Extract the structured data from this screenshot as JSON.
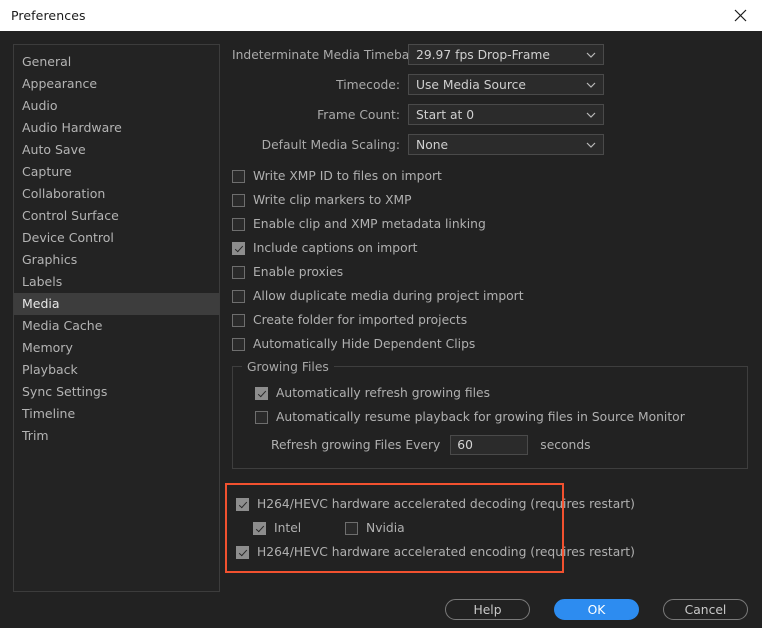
{
  "window": {
    "title": "Preferences",
    "close_icon": "close-icon"
  },
  "sidebar": {
    "items": [
      {
        "label": "General",
        "selected": false
      },
      {
        "label": "Appearance",
        "selected": false
      },
      {
        "label": "Audio",
        "selected": false
      },
      {
        "label": "Audio Hardware",
        "selected": false
      },
      {
        "label": "Auto Save",
        "selected": false
      },
      {
        "label": "Capture",
        "selected": false
      },
      {
        "label": "Collaboration",
        "selected": false
      },
      {
        "label": "Control Surface",
        "selected": false
      },
      {
        "label": "Device Control",
        "selected": false
      },
      {
        "label": "Graphics",
        "selected": false
      },
      {
        "label": "Labels",
        "selected": false
      },
      {
        "label": "Media",
        "selected": true
      },
      {
        "label": "Media Cache",
        "selected": false
      },
      {
        "label": "Memory",
        "selected": false
      },
      {
        "label": "Playback",
        "selected": false
      },
      {
        "label": "Sync Settings",
        "selected": false
      },
      {
        "label": "Timeline",
        "selected": false
      },
      {
        "label": "Trim",
        "selected": false
      }
    ]
  },
  "main": {
    "dropdowns": [
      {
        "label": "Indeterminate Media Timebase:",
        "value": "29.97 fps Drop-Frame"
      },
      {
        "label": "Timecode:",
        "value": "Use Media Source"
      },
      {
        "label": "Frame Count:",
        "value": "Start at 0"
      },
      {
        "label": "Default Media Scaling:",
        "value": "None"
      }
    ],
    "checkboxes": [
      {
        "label": "Write XMP ID to files on import",
        "checked": false
      },
      {
        "label": "Write clip markers to XMP",
        "checked": false
      },
      {
        "label": "Enable clip and XMP metadata linking",
        "checked": false
      },
      {
        "label": "Include captions on import",
        "checked": true
      },
      {
        "label": "Enable proxies",
        "checked": false
      },
      {
        "label": "Allow duplicate media during project import",
        "checked": false
      },
      {
        "label": "Create folder for imported projects",
        "checked": false
      },
      {
        "label": "Automatically Hide Dependent Clips",
        "checked": false
      }
    ],
    "growing_files": {
      "legend": "Growing Files",
      "auto_refresh": {
        "label": "Automatically refresh growing files",
        "checked": true
      },
      "auto_resume": {
        "label": "Automatically resume playback for growing files in Source Monitor",
        "checked": false
      },
      "refresh_label": "Refresh growing Files Every",
      "refresh_value": "60",
      "seconds_label": "seconds"
    },
    "hardware": {
      "decoding": {
        "label": "H264/HEVC hardware accelerated decoding (requires restart)",
        "checked": true
      },
      "intel": {
        "label": "Intel",
        "checked": true
      },
      "nvidia": {
        "label": "Nvidia",
        "checked": false
      },
      "encoding": {
        "label": "H264/HEVC hardware accelerated encoding (requires restart)",
        "checked": true
      },
      "highlight_color": "#f2512f"
    }
  },
  "footer": {
    "help_label": "Help",
    "ok_label": "OK",
    "cancel_label": "Cancel",
    "primary_color": "#2d8cf0"
  }
}
